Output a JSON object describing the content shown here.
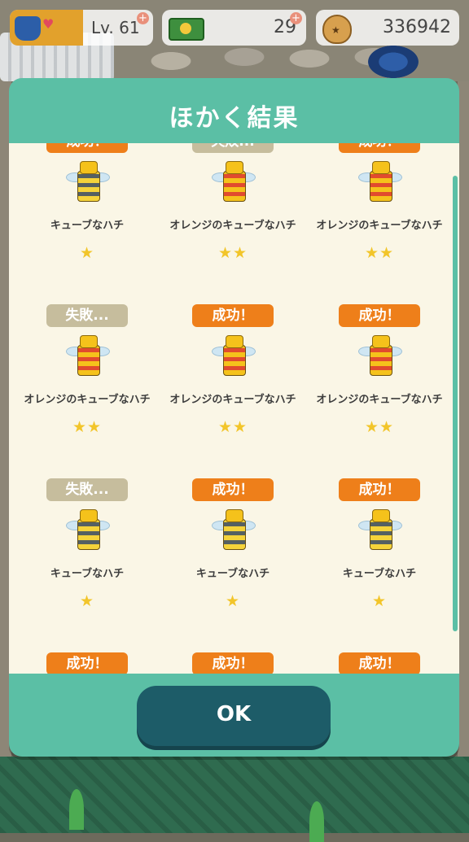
{
  "status_bar": {
    "level": "Lv. 61",
    "tickets": "29",
    "coins": "336942",
    "plus_label": "+"
  },
  "dialog": {
    "title": "ほかく結果",
    "ok_label": "OK"
  },
  "results": [
    {
      "status": "成功！",
      "success": true,
      "name": "キューブなハチ",
      "stars": "★",
      "bee": "yellow"
    },
    {
      "status": "失敗...",
      "success": false,
      "name": "オレンジのキューブなハチ",
      "stars": "★★",
      "bee": "orange"
    },
    {
      "status": "成功！",
      "success": true,
      "name": "オレンジのキューブなハチ",
      "stars": "★★",
      "bee": "orange"
    },
    {
      "status": "失敗...",
      "success": false,
      "name": "オレンジのキューブなハチ",
      "stars": "★★",
      "bee": "orange"
    },
    {
      "status": "成功！",
      "success": true,
      "name": "オレンジのキューブなハチ",
      "stars": "★★",
      "bee": "orange"
    },
    {
      "status": "成功！",
      "success": true,
      "name": "オレンジのキューブなハチ",
      "stars": "★★",
      "bee": "orange"
    },
    {
      "status": "失敗...",
      "success": false,
      "name": "キューブなハチ",
      "stars": "★",
      "bee": "yellow"
    },
    {
      "status": "成功！",
      "success": true,
      "name": "キューブなハチ",
      "stars": "★",
      "bee": "yellow"
    },
    {
      "status": "成功！",
      "success": true,
      "name": "キューブなハチ",
      "stars": "★",
      "bee": "yellow"
    },
    {
      "status": "成功！",
      "success": true,
      "name": "",
      "stars": "",
      "bee": ""
    },
    {
      "status": "成功！",
      "success": true,
      "name": "",
      "stars": "",
      "bee": ""
    },
    {
      "status": "成功！",
      "success": true,
      "name": "",
      "stars": "",
      "bee": ""
    }
  ],
  "colors": {
    "success_badge": "#ee7f1a",
    "fail_badge": "#c6bd9d",
    "dialog_frame": "#5bbfa5",
    "panel": "#faf6e6",
    "ok_button": "#1d5c68"
  }
}
